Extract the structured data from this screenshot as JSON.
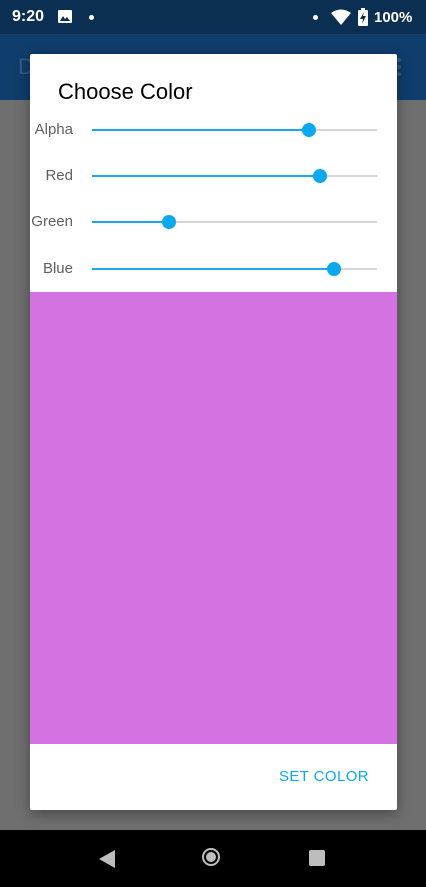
{
  "status_bar": {
    "time": "9:20",
    "battery": "100%",
    "icons": [
      "photo-icon",
      "notification-dot",
      "wifi-icon",
      "battery-charging-icon"
    ]
  },
  "app_bar": {
    "title": "D"
  },
  "dialog": {
    "title": "Choose Color",
    "sliders": [
      {
        "label": "Alpha",
        "value": 0.76
      },
      {
        "label": "Red",
        "value": 0.8
      },
      {
        "label": "Green",
        "value": 0.27
      },
      {
        "label": "Blue",
        "value": 0.85
      }
    ],
    "preview_color": "#d572e1",
    "action_label": "SET COLOR"
  },
  "colors": {
    "accent": "#0aa8ef",
    "status_bar": "#0b2f52",
    "scrim": "#6f6f6f"
  }
}
